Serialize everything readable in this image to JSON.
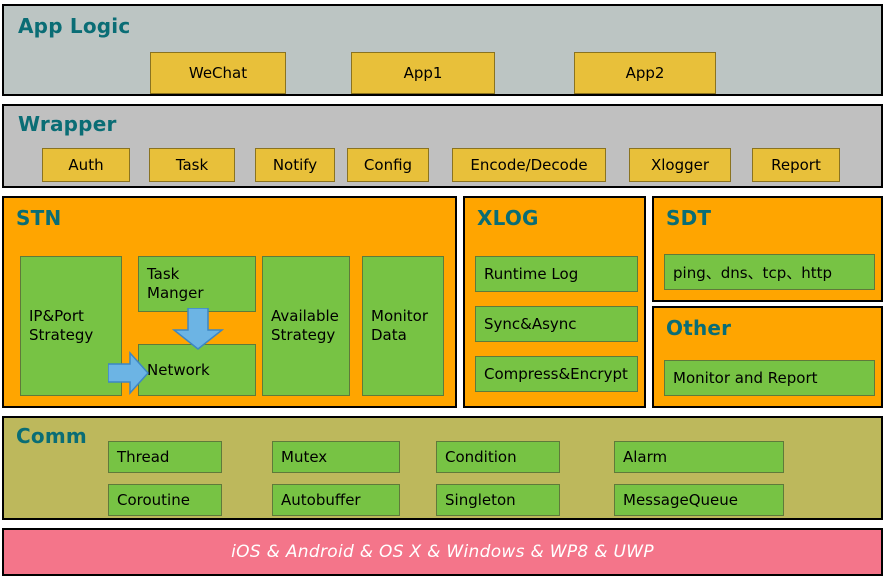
{
  "colors": {
    "app_logic_bg": "#bcc5c3",
    "wrapper_bg": "#c0c0c0",
    "orange": "#ffa500",
    "green": "#77c344",
    "yellow": "#e8c03a",
    "olive": "#bdb85c",
    "pink": "#f4758a",
    "heading_teal": "#0a6d75",
    "arrow_blue": "#6cb4e4",
    "arrow_blue_border": "#3d87c4"
  },
  "app_logic": {
    "title": "App Logic",
    "modules": [
      {
        "label": "WeChat"
      },
      {
        "label": "App1"
      },
      {
        "label": "App2"
      }
    ]
  },
  "wrapper": {
    "title": "Wrapper",
    "modules": [
      {
        "label": "Auth"
      },
      {
        "label": "Task"
      },
      {
        "label": "Notify"
      },
      {
        "label": "Config"
      },
      {
        "label": "Encode/Decode"
      },
      {
        "label": "Xlogger"
      },
      {
        "label": "Report"
      }
    ]
  },
  "stn": {
    "title": "STN",
    "modules": [
      {
        "label": "IP&Port\nStrategy",
        "line1": "IP&Port",
        "line2": "Strategy"
      },
      {
        "label": "Task Manger",
        "line1": "Task",
        "line2": "Manger"
      },
      {
        "label": "Network"
      },
      {
        "label": "Available Strategy",
        "line1": "Available",
        "line2": "Strategy"
      },
      {
        "label": "Monitor Data",
        "line1": "Monitor",
        "line2": "Data"
      }
    ],
    "arrows": [
      {
        "name": "task-manger-to-network",
        "direction": "down"
      },
      {
        "name": "ipport-strategy-to-network",
        "direction": "right"
      }
    ]
  },
  "xlog": {
    "title": "XLOG",
    "modules": [
      {
        "label": "Runtime Log"
      },
      {
        "label": "Sync&Async"
      },
      {
        "label": "Compress&Encrypt"
      }
    ]
  },
  "sdt": {
    "title": "SDT",
    "modules": [
      {
        "label": "ping、dns、tcp、http"
      }
    ]
  },
  "other": {
    "title": "Other",
    "modules": [
      {
        "label": "Monitor and Report"
      }
    ]
  },
  "comm": {
    "title": "Comm",
    "row1": [
      {
        "label": "Thread"
      },
      {
        "label": "Mutex"
      },
      {
        "label": "Condition"
      },
      {
        "label": "Alarm"
      }
    ],
    "row2": [
      {
        "label": "Coroutine"
      },
      {
        "label": "Autobuffer"
      },
      {
        "label": "Singleton"
      },
      {
        "label": "MessageQueue"
      }
    ]
  },
  "platform": {
    "label": "iOS & Android & OS X & Windows & WP8 & UWP"
  }
}
